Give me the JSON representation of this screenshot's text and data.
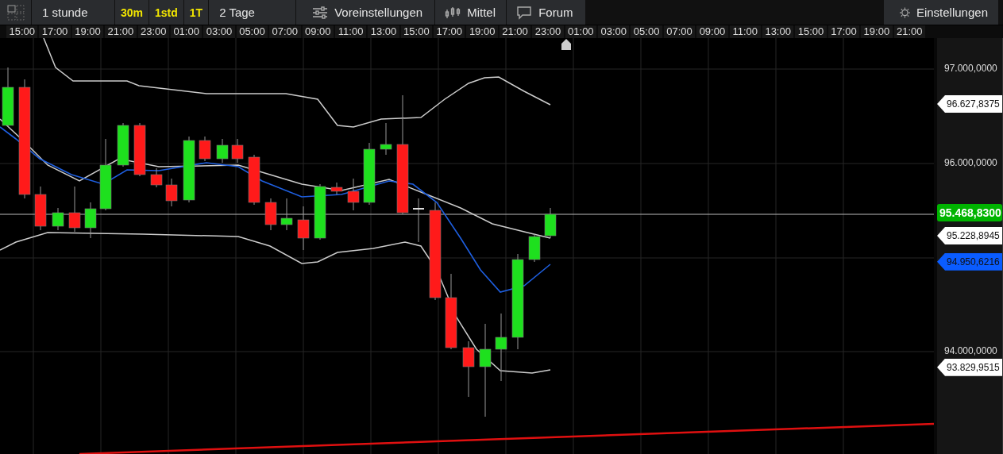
{
  "toolbar": {
    "items": [
      {
        "kind": "range",
        "label": "1 stunde"
      },
      {
        "kind": "shortcut",
        "label": "30m"
      },
      {
        "kind": "shortcut",
        "label": "1std"
      },
      {
        "kind": "shortcut",
        "label": "1T"
      },
      {
        "kind": "range",
        "label": "2 Tage"
      },
      {
        "kind": "presets",
        "label": "Voreinstellungen"
      },
      {
        "kind": "indicators",
        "label": "Mittel"
      },
      {
        "kind": "forum",
        "label": "Forum"
      },
      {
        "kind": "settings",
        "label": "Einstellungen"
      }
    ]
  },
  "time_axis": [
    "15:00",
    "17:00",
    "19:00",
    "21:00",
    "23:00",
    "01:00",
    "03:00",
    "05:00",
    "07:00",
    "09:00",
    "11:00",
    "13:00",
    "15:00",
    "17:00",
    "19:00",
    "21:00",
    "23:00",
    "01:00",
    "03:00",
    "05:00",
    "07:00",
    "09:00",
    "11:00",
    "13:00",
    "15:00",
    "17:00",
    "19:00",
    "21:00"
  ],
  "price_axis": [
    {
      "kind": "tick",
      "label": "97.000,0000"
    },
    {
      "kind": "tag",
      "label": "96.627,8375",
      "color": "#ffffff"
    },
    {
      "kind": "tick",
      "label": "96.000,0000"
    },
    {
      "kind": "tag",
      "label": "95.468,8300",
      "color": "#00b400"
    },
    {
      "kind": "tag",
      "label": "95.228,8945",
      "color": "#ffffff"
    },
    {
      "kind": "tag",
      "label": "94.950,6216",
      "color": "#0a5cff"
    },
    {
      "kind": "tick",
      "label": "94.000,0000"
    },
    {
      "kind": "tag",
      "label": "93.829,9515",
      "color": "#ffffff"
    }
  ]
}
